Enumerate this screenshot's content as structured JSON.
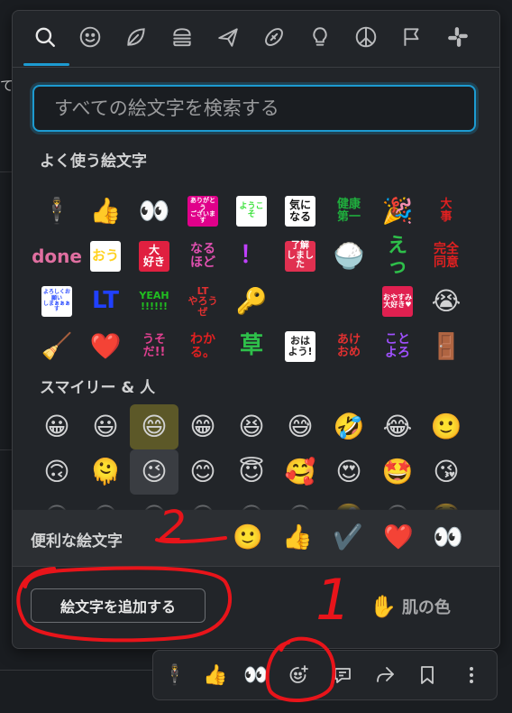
{
  "background": {
    "fragment_text": "て"
  },
  "tabs": [
    {
      "name": "search-tab-icon",
      "selected": true
    },
    {
      "name": "smiley-tab-icon"
    },
    {
      "name": "leaf-tab-icon"
    },
    {
      "name": "burger-tab-icon"
    },
    {
      "name": "airplane-tab-icon"
    },
    {
      "name": "football-tab-icon"
    },
    {
      "name": "lightbulb-tab-icon"
    },
    {
      "name": "peace-tab-icon"
    },
    {
      "name": "flag-tab-icon"
    },
    {
      "name": "slack-tab-icon"
    }
  ],
  "search": {
    "placeholder": "すべての絵文字を検索する"
  },
  "frequent": {
    "title": "よく使う絵文字",
    "rows": [
      [
        {
          "e": "🕴"
        },
        {
          "e": "👍"
        },
        {
          "e": "👀"
        },
        {
          "t": "ありがとう\nございます",
          "fg": "#ffffff",
          "bg": "#e0008a",
          "fs": 7
        },
        {
          "t": "ようこそ",
          "fg": "#3fe23f",
          "bg": "#ffffff",
          "fs": 9
        },
        {
          "t": "気に\nなる",
          "fg": "#111111",
          "bg": "#ffffff",
          "fs": 12
        },
        {
          "t": "健康\n第一",
          "fg": "#1fae3d",
          "bg": "",
          "fs": 13
        },
        {
          "e": "🎉"
        },
        {
          "t": "大\n事",
          "fg": "#e02020",
          "bg": "",
          "fs": 13
        }
      ],
      [
        {
          "t": "done",
          "fg": "#e06fa0",
          "bg": "",
          "fs": 20
        },
        {
          "t": "おう",
          "fg": "#ffd21f",
          "bg": "#ffffff",
          "fs": 15
        },
        {
          "t": "大\n好き",
          "fg": "#ffffff",
          "bg": "#e02040",
          "fs": 12
        },
        {
          "t": "なる\nほど",
          "fg": "#e050b0",
          "bg": "",
          "fs": 14
        },
        {
          "t": "！",
          "fg": "#c040ff",
          "bg": "",
          "fs": 26
        },
        {
          "t": "了解\nしました",
          "fg": "#ffffff",
          "bg": "#e03050",
          "fs": 10
        },
        {
          "e": "🍚"
        },
        {
          "t": "えっ",
          "fg": "#2ec04a",
          "bg": "",
          "fs": 22
        },
        {
          "t": "完全\n同意",
          "fg": "#e02020",
          "bg": "",
          "fs": 14
        }
      ],
      [
        {
          "t": "よろしくお願い\nしまぁぁぁす",
          "fg": "#3050ff",
          "bg": "#ffffff",
          "fs": 6
        },
        {
          "t": "LT",
          "fg": "#2040ff",
          "bg": "",
          "fs": 26
        },
        {
          "t": "YEAH\n!!!!!!",
          "fg": "#20c020",
          "bg": "",
          "fs": 11
        },
        {
          "t": "LT\nやろうぜ",
          "fg": "#e03030",
          "bg": "",
          "fs": 11
        },
        {
          "e": "🔑"
        },
        {
          "e": ""
        },
        {
          "e": ""
        },
        {
          "t": "おやすみ\n大好き♥",
          "fg": "#ffffff",
          "bg": "#e02050",
          "fs": 8
        },
        {
          "e": "😭"
        }
      ],
      [
        {
          "e": "🧹"
        },
        {
          "e": "❤️"
        },
        {
          "t": "うそ\nだ!!",
          "fg": "#e04090",
          "bg": "",
          "fs": 13
        },
        {
          "t": "わか\nる。",
          "fg": "#e02020",
          "bg": "",
          "fs": 14
        },
        {
          "t": "草",
          "fg": "#2ec04a",
          "bg": "",
          "fs": 26
        },
        {
          "t": "おは\nよう!",
          "fg": "#222222",
          "bg": "#ffffff",
          "fs": 11
        },
        {
          "t": "あけ\nおめ",
          "fg": "#e03030",
          "bg": "",
          "fs": 13
        },
        {
          "t": "こと\nよろ",
          "fg": "#a050ff",
          "bg": "",
          "fs": 14
        },
        {
          "e": "🚪"
        }
      ]
    ]
  },
  "smileys": {
    "title": "スマイリー & 人",
    "rows": [
      [
        "😀",
        "😃",
        "😄",
        "😁",
        "😆",
        "😅",
        "🤣",
        "😂",
        "🙂"
      ],
      [
        "🙃",
        "🫠",
        "😉",
        "😊",
        "😇",
        "🥰",
        "😍",
        "🤩",
        "😘"
      ],
      [
        "😗",
        "😙",
        "😚",
        "😋",
        "😛",
        "😜",
        "🤪",
        "😝",
        "🤑"
      ]
    ]
  },
  "handy": {
    "title": "便利な絵文字",
    "emojis": [
      "🙂",
      "👍",
      "✔️",
      "❤️",
      "👀"
    ]
  },
  "footer": {
    "add_button": "絵文字を追加する",
    "skin_hand": "✋",
    "skin_label": "肌の色"
  },
  "toolbar": {
    "emoji1": "🕴",
    "emoji2": "👍",
    "emoji3": "👀"
  },
  "annotations": {
    "label_1": "1",
    "label_2": "2",
    "color": "#e8141a"
  }
}
